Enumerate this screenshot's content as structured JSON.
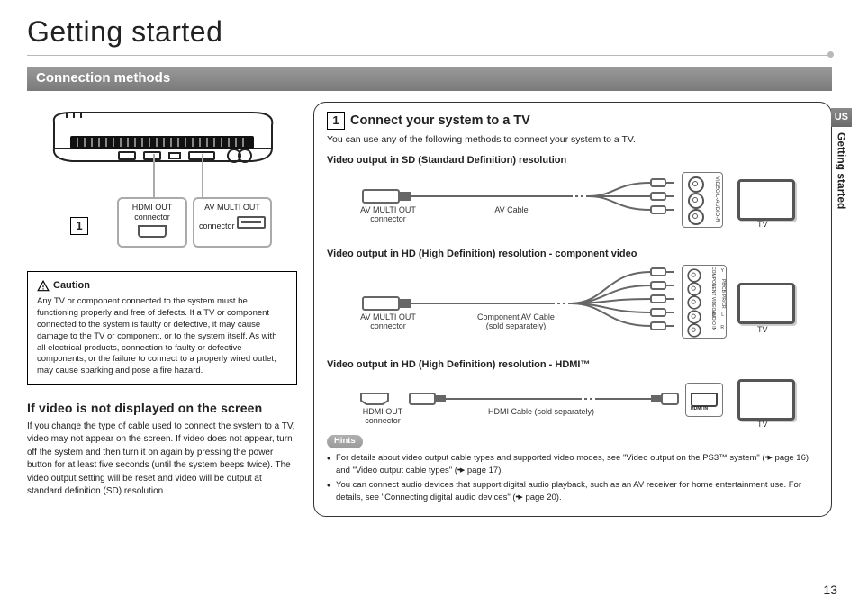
{
  "page_title": "Getting started",
  "section_bar": "Connection methods",
  "side_tab_lang": "US",
  "side_tab_text": "Getting started",
  "page_number": "13",
  "step_number": "1",
  "console_callouts": {
    "hdmi_out": {
      "line1": "HDMI OUT",
      "line2": "connector"
    },
    "av_multi_out": {
      "line1": "AV MULTI OUT",
      "line2": "connector"
    }
  },
  "caution": {
    "title": "Caution",
    "body": "Any TV or component connected to the system must be functioning properly and free of defects. If a TV or component connected to the system is faulty or defective, it may cause damage to the TV or component, or to the system itself. As with all electrical products, connection to faulty or defective components, or the failure to connect to a properly wired outlet, may cause sparking and pose a fire hazard."
  },
  "no_video_heading": "If video is not displayed on the screen",
  "no_video_body": "If you change the type of cable used to connect the system to a TV, video may not appear on the screen. If video does not appear, turn off the system and then turn it on again by pressing the power button for at least five seconds (until the system beeps twice). The video output setting will be reset and video will be output at standard definition (SD) resolution.",
  "panel": {
    "heading": "Connect your system to a TV",
    "intro": "You can use any of the following methods to connect your system to a TV.",
    "method1": {
      "title": "Video output in SD (Standard Definition) resolution",
      "conn_label": "AV MULTI OUT\nconnector",
      "cable_label": "AV Cable",
      "tv_label": "TV",
      "jacks": {
        "video": "VIDEO",
        "l": "L-AUDIO-R"
      }
    },
    "method2": {
      "title": "Video output in HD (High Definition) resolution - component video",
      "conn_label": "AV MULTI OUT\nconnector",
      "cable_label": "Component AV Cable\n(sold separately)",
      "tv_label": "TV",
      "jack_group1": "COMPONENT VIDEO IN",
      "jack_group2": "AUDIO IN",
      "jacks": [
        "Y",
        "PB/CB",
        "PR/CR",
        "L",
        "R"
      ]
    },
    "method3": {
      "title": "Video output in HD (High Definition) resolution - HDMI™",
      "conn_label": "HDMI OUT\nconnector",
      "cable_label": "HDMI Cable (sold separately)",
      "tv_label": "TV",
      "port_label": "HDMI IN"
    },
    "hints_tag": "Hints",
    "hints": [
      {
        "text_a": "For details about video output cable types and supported video modes, see \"Video output on the PS3™ system\" (",
        "ref1": "page 16",
        "text_b": ") and \"Video output cable types\" (",
        "ref2": "page 17",
        "text_c": ")."
      },
      {
        "text_a": "You can connect audio devices that support digital audio playback, such as an AV receiver for home entertainment use. For details, see \"Connecting digital audio devices\" (",
        "ref1": "page 20",
        "text_b": ").",
        "ref2": "",
        "text_c": ""
      }
    ]
  }
}
